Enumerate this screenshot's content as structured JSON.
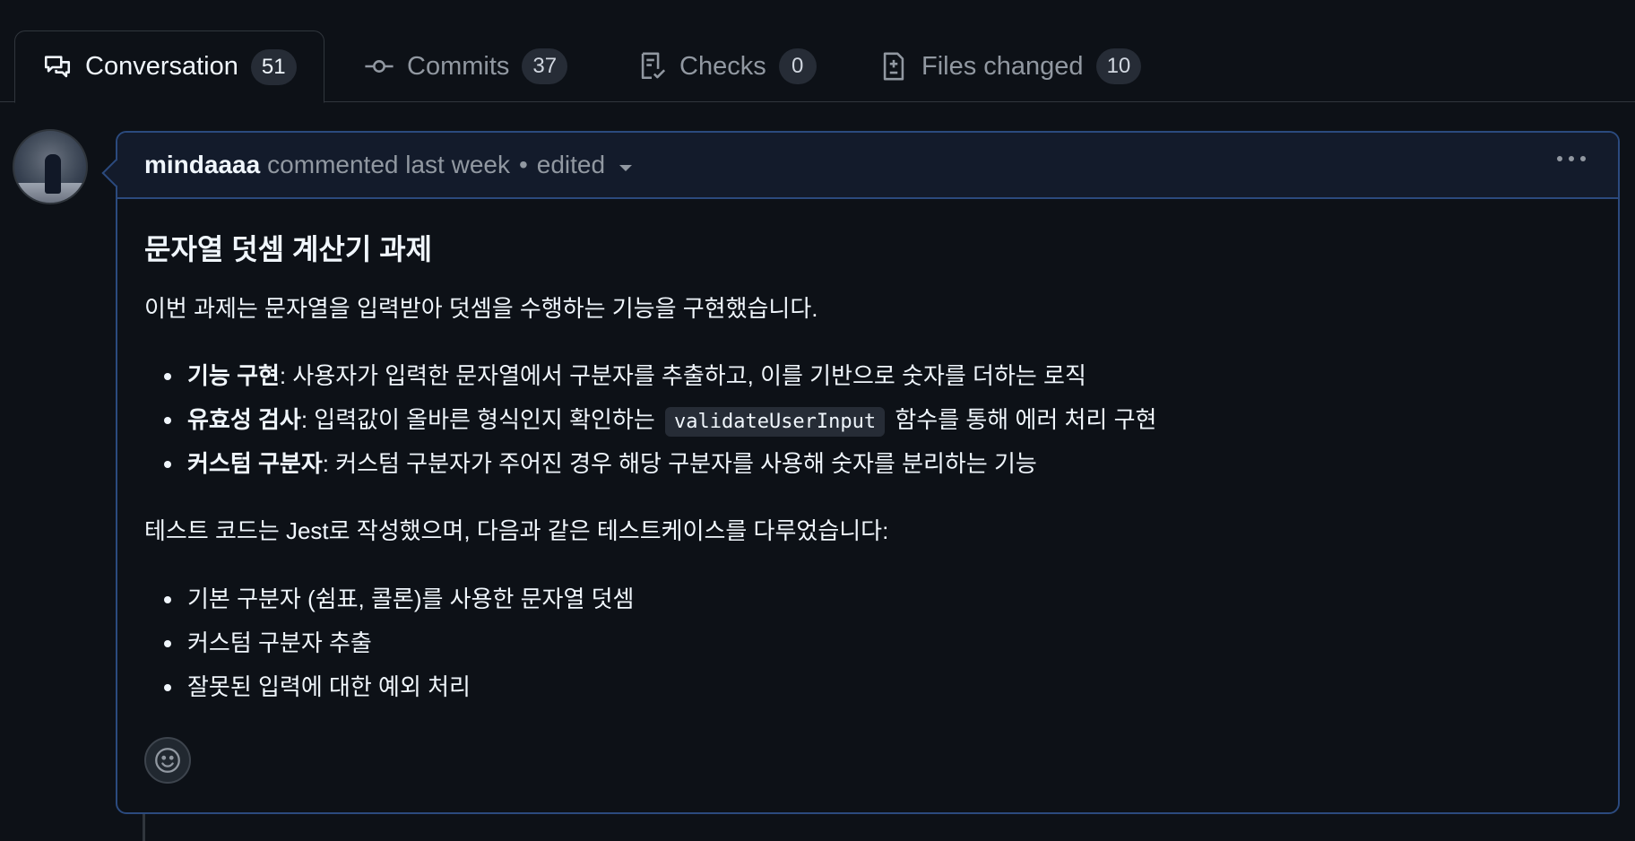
{
  "tabs": [
    {
      "label": "Conversation",
      "count": "51",
      "icon": "comment-discussion-icon",
      "active": true
    },
    {
      "label": "Commits",
      "count": "37",
      "icon": "git-commit-icon",
      "active": false
    },
    {
      "label": "Checks",
      "count": "0",
      "icon": "checklist-icon",
      "active": false
    },
    {
      "label": "Files changed",
      "count": "10",
      "icon": "file-diff-icon",
      "active": false
    }
  ],
  "comment": {
    "author": "mindaaaa",
    "action": "commented last week",
    "separator": "•",
    "edited": "edited",
    "heading": "문자열 덧셈 계산기 과제",
    "intro": "이번 과제는 문자열을 입력받아 덧셈을 수행하는 기능을 구현했습니다.",
    "features": [
      {
        "title": "기능 구현",
        "text": ": 사용자가 입력한 문자열에서 구분자를 추출하고, 이를 기반으로 숫자를 더하는 로직"
      },
      {
        "title": "유효성 검사",
        "text": ": 입력값이 올바른 형식인지 확인하는",
        "code": "validateUserInput",
        "text_after": "함수를 통해 에러 처리 구현"
      },
      {
        "title": "커스텀 구분자",
        "text": ": 커스텀 구분자가 주어진 경우 해당 구분자를 사용해 숫자를 분리하는 기능"
      }
    ],
    "test_intro": "테스트 코드는 Jest로 작성했으며, 다음과 같은 테스트케이스를 다루었습니다:",
    "test_cases": [
      "기본 구분자 (쉼표, 콜론)를 사용한 문자열 덧셈",
      "커스텀 구분자 추출",
      "잘못된 입력에 대한 예외 처리"
    ]
  },
  "colors": {
    "background": "#0d1117",
    "accent_border": "#2b4a7e",
    "header_bg": "#131b2b",
    "counter_bg": "#262c36",
    "muted_text": "#9198a1"
  }
}
